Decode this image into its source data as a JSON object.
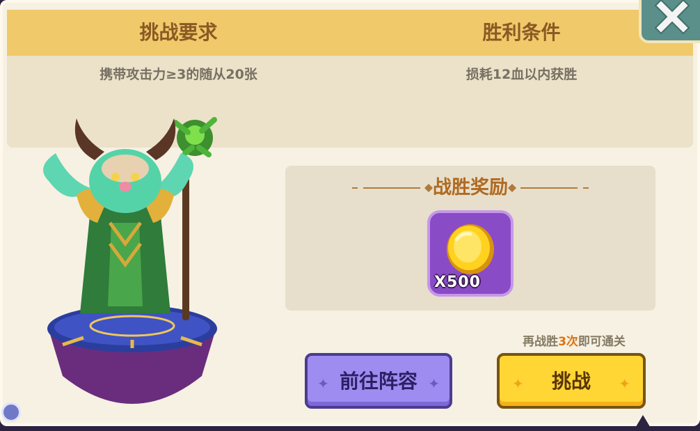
{
  "requirements": {
    "challenge_title": "挑战要求",
    "challenge_text": "携带攻击力≥3的随从20张",
    "victory_title": "胜利条件",
    "victory_text": "损耗12血以内获胜"
  },
  "reward": {
    "title": "战胜奖励",
    "item_icon": "gold-coin-icon",
    "quantity": "X500"
  },
  "hint": {
    "prefix": "再战胜",
    "count": "3次",
    "suffix": "即可通关"
  },
  "buttons": {
    "lineup_label": "前往阵容",
    "challenge_label": "挑战",
    "close_icon": "close-icon"
  },
  "colors": {
    "header": "#f0c96a",
    "title_text": "#8a5a24",
    "reward_title": "#b06a20",
    "reward_bg": "#8a4bc7",
    "lineup_button": "#9e8cf0",
    "challenge_button": "#ffd633",
    "highlight": "#dc7412"
  }
}
